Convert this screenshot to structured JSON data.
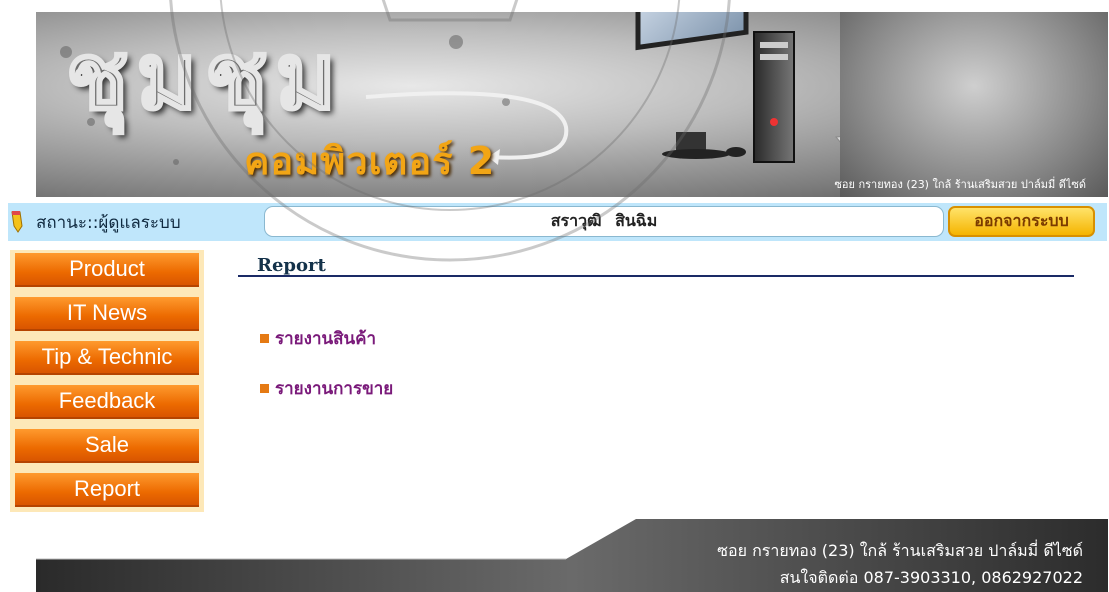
{
  "header": {
    "logo_thai": "ชุมชุม",
    "logo_sub": "คอมพิวเตอร์ 2",
    "address_small": "ซอย กรายทอง (23) ใกล้ ร้านเสริมสวย ปาล์มมี่ ดีไซด์"
  },
  "status": {
    "label": "สถานะ::ผู้ดูแลระบบ",
    "user_name": "สราวุฒิ   สินฉิม",
    "logout_label": "ออกจากระบบ"
  },
  "sidebar": {
    "items": [
      {
        "label": "Product"
      },
      {
        "label": "IT News"
      },
      {
        "label": "Tip & Technic"
      },
      {
        "label": "Feedback"
      },
      {
        "label": "Sale"
      },
      {
        "label": "Report"
      }
    ]
  },
  "main": {
    "title": "Report",
    "links": [
      {
        "label": "รายงานสินค้า"
      },
      {
        "label": "รายงานการขาย"
      }
    ]
  },
  "footer": {
    "line1": "ซอย กรายทอง (23) ใกล้ ร้านเสริมสวย ปาล์มมี่ ดีไซด์",
    "line2": "สนใจติดต่อ 087-3903310, 0862927022"
  },
  "colors": {
    "status_bar": "#bfe6fb",
    "nav_orange": "#ec6a00",
    "sidebar_bg": "#fde8b8",
    "link_purple": "#7a1a7a",
    "title_rule": "#1a2a66",
    "logout_gold": "#f5b400"
  },
  "icons": {
    "status_icon": "pencil-icon",
    "bullet_icon": "square-bullet-icon"
  }
}
